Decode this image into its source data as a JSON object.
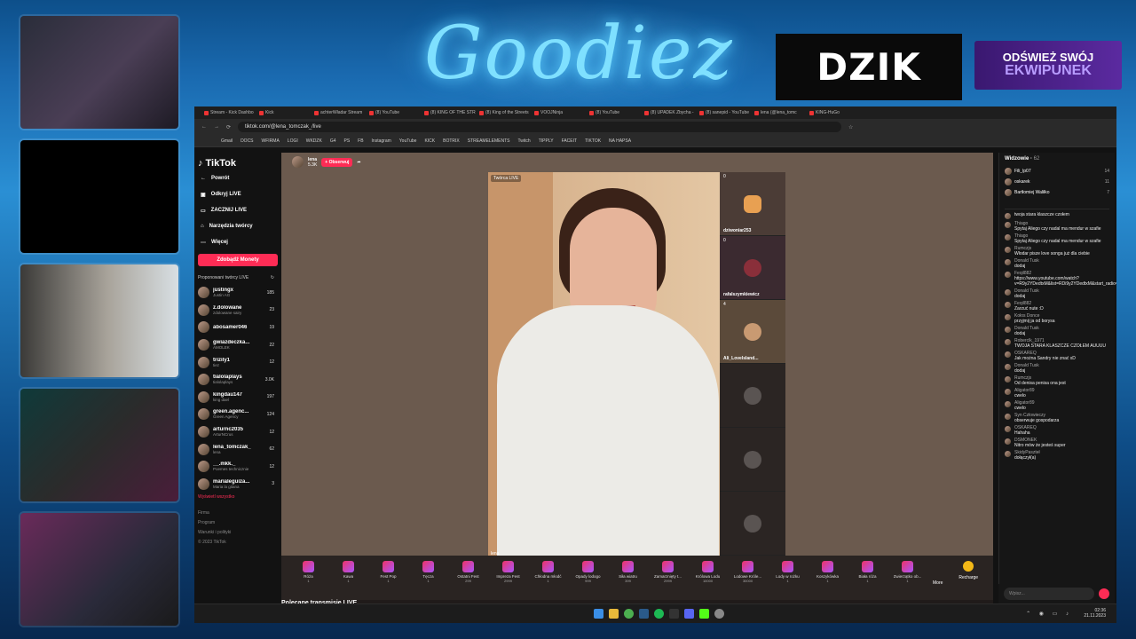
{
  "overlay": {
    "logo": "Goodiez",
    "dzik": "DZIK",
    "ekw_line1": "ODŚWIEŻ SWÓJ",
    "ekw_line2": "EKWIPUNEK"
  },
  "browser": {
    "tabs": [
      "Stream - Kick Dashbo",
      "Kick",
      "achterWładar Stream",
      "(8) YouTube",
      "(8) KING OF THE STR",
      "(8) King of the Streets",
      "VOOJNinja",
      "(8) YouTube",
      "(8) UPADEK Zbycha -",
      "(8) sanepid - YouTube",
      "lena (@lena_tomc",
      "KING-HuGo"
    ],
    "url": "tiktok.com/@lena_tomczak_/live",
    "bookmarks": [
      "Gmail",
      "DOCS",
      "WFIRMA",
      "LOGI",
      "WKDZK",
      "G4",
      "PS",
      "FB",
      "Instagram",
      "YouTube",
      "KICK",
      "BOTRIX",
      "STREAMELEMENTS",
      "Twitch",
      "TIPPLY",
      "FACEIT",
      "TIKTOK",
      "NA HAPSA"
    ]
  },
  "tiktok": {
    "brand": "TikTok",
    "nav": [
      "Powrót",
      "Odkryj LIVE",
      "ZACZNIJ LIVE",
      "Narzędzia twórcy",
      "Więcej"
    ],
    "coins": "Zdobądź Monety",
    "suggested_title": "Proponowani twórcy LIVE",
    "creators": [
      {
        "name": "justingx",
        "sub": "Justin AG",
        "v": "185"
      },
      {
        "name": "z.dolowane",
        "sub": "zdolowane sairy",
        "v": "23"
      },
      {
        "name": "abosamer046",
        "sub": "",
        "v": "19"
      },
      {
        "name": "gwiazdeczka...",
        "sub": "AMOLEK",
        "v": "22"
      },
      {
        "name": "trizily1",
        "sub": "tiez",
        "v": "12"
      },
      {
        "name": "tialolaplays",
        "sub": "tialolaplays",
        "v": "3.0K"
      },
      {
        "name": "kingdau147",
        "sub": "king dael",
        "v": "197"
      },
      {
        "name": "green.agenc...",
        "sub": "Green Agency",
        "v": "124"
      },
      {
        "name": "arturnc2035",
        "sub": "ArturNCrus",
        "v": "12"
      },
      {
        "name": "lena_tomczak_",
        "sub": "lena",
        "v": "62"
      },
      {
        "name": "__.mkk._",
        "sub": "Poemes technicznie",
        "v": "12"
      },
      {
        "name": "marialeguiza...",
        "sub": "Maria la gitana",
        "v": "3"
      }
    ],
    "see_all": "Wyświetl wszystko",
    "footer": [
      "Firma",
      "Program",
      "Warunki i polityki",
      "© 2023 TikTok"
    ]
  },
  "stream": {
    "host": "lena",
    "host_likes": "5.3K",
    "follow": "+ Obserwuj",
    "video_label": "Twórca LIVE",
    "video_name": "lena",
    "guests": [
      {
        "name": "dziwoniar253",
        "count": "0"
      },
      {
        "name": "rafalszymkiewicz",
        "count": "0"
      },
      {
        "name": "Ali_Lovelsland...",
        "count": "4"
      }
    ],
    "gifts": [
      {
        "n": "Róża",
        "p": "1"
      },
      {
        "n": "Kawa",
        "p": "1"
      },
      {
        "n": "Fest Pop",
        "p": "1"
      },
      {
        "n": "Tęcza",
        "p": "1"
      },
      {
        "n": "Ostatni Fest",
        "p": "299"
      },
      {
        "n": "Impreza Fest",
        "p": "2999"
      },
      {
        "n": "Chłodna młodć",
        "p": "1"
      },
      {
        "n": "Opady lodogo",
        "p": "999"
      },
      {
        "n": "Siła wiatru",
        "p": "399"
      },
      {
        "n": "Zamarznięty t...",
        "p": "2999"
      },
      {
        "n": "Królowa Lodu",
        "p": "10000"
      },
      {
        "n": "Lodowe Króle...",
        "p": "30000"
      },
      {
        "n": "Lody w rożku",
        "p": "1"
      },
      {
        "n": "Koszykówka",
        "p": "1"
      },
      {
        "n": "Biała róża",
        "p": "1"
      },
      {
        "n": "Zwierzątko ob...",
        "p": "1"
      }
    ],
    "more": "More",
    "recharge": "Recharge",
    "polecane": "Polecane transmisje LIVE"
  },
  "chat": {
    "viewers_label": "Widzowie",
    "viewers_count": "62",
    "viewers": [
      {
        "n": "Fili_lp07",
        "c": "14"
      },
      {
        "n": "oskarek",
        "c": "11"
      },
      {
        "n": "Bartłomiej Waliłko",
        "c": "7"
      }
    ],
    "messages": [
      {
        "u": "",
        "t": "twoja stara klaszcze czołem"
      },
      {
        "u": "Thiago",
        "t": "Spytaj Aliego czy nadal ma mendur w szafie"
      },
      {
        "u": "Thiago",
        "t": "Spytaj Aliego czy nadal ma mendur w szafie"
      },
      {
        "u": "Rumczjs",
        "t": "Włodar pisze love songa już dla ciebie"
      },
      {
        "u": "Donald Tusk",
        "t": "dodaj"
      },
      {
        "u": "Feqil882",
        "t": "https://www.youtube.com/watch?v=R9y2YDedtxM&list=RDi9y2YDedtxM&start_radio=1"
      },
      {
        "u": "Donald Tusk",
        "t": "dodaj"
      },
      {
        "u": "Feqil882",
        "t": "Zarzuć nute :D"
      },
      {
        "u": "Kołos Donce",
        "t": "przyjmij ja od borysa"
      },
      {
        "u": "Donald Tusk",
        "t": "dodaj"
      },
      {
        "u": "Roberclk_1971",
        "t": "TWOJA STARA KLASZCZE CZOŁEM AUUUU"
      },
      {
        "u": "OSKAREQ",
        "t": "Jak można Sandry nie znać xD"
      },
      {
        "u": "Donald Tusk",
        "t": "dodaj"
      },
      {
        "u": "Rumczjs",
        "t": "Od denisa penisa ona jest"
      },
      {
        "u": "Aligator89",
        "t": "cwelo"
      },
      {
        "u": "Aligator89",
        "t": "cwelo"
      },
      {
        "u": "Syn Człowieczy",
        "t": "obserwuje gospodarza"
      },
      {
        "u": "OSKAREQ",
        "t": "Hahaha"
      },
      {
        "u": "DSMONEK",
        "t": "Nitro mów że jesteś super"
      },
      {
        "u": "SkidyPaszteł",
        "t": "dołączył(a)"
      }
    ],
    "input_placeholder": "Wpisz..."
  },
  "taskbar": {
    "time": "02:36",
    "date": "21.11.2023"
  },
  "colors": {
    "tiktok_accent": "#fe2c55",
    "logo": "#7fe0ff"
  }
}
